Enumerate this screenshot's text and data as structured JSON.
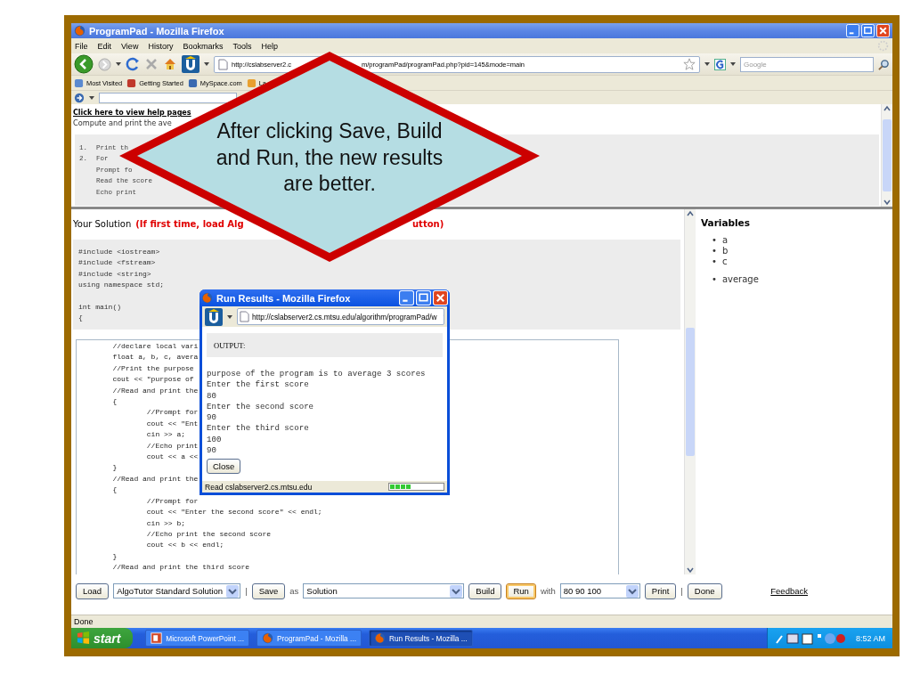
{
  "window": {
    "title": "ProgramPad - Mozilla Firefox"
  },
  "menu": [
    "File",
    "Edit",
    "View",
    "History",
    "Bookmarks",
    "Tools",
    "Help"
  ],
  "address_bar": {
    "url_start": "http://cslabserver2.c",
    "url_end": "m/programPad/programPad.php?pid=145&mode=main"
  },
  "search": {
    "placeholder": "Google"
  },
  "bookmarks": [
    "Most Visited",
    "Getting Started",
    "MySpace.com",
    "La"
  ],
  "help_frame": {
    "link": "Click here to view help pages",
    "description": "Compute and print the ave",
    "steps": [
      {
        "number": "1.",
        "text": "Print th"
      },
      {
        "number": "2.",
        "text": "For"
      },
      {
        "text": "Prompt fo"
      },
      {
        "text": "Read the score"
      },
      {
        "text": "Echo print"
      }
    ]
  },
  "solution": {
    "title": "Your Solution",
    "hint_start": "(If first time, load Alg",
    "hint_end": "utton)",
    "header_code": [
      [
        "#include <iostream>",
        "#include <fstream>",
        "#include <string>",
        "using namespace std;"
      ],
      [
        "int main()",
        "{"
      ]
    ],
    "editor_lines": [
      "\t//declare local vari",
      "\tfloat a, b, c, avera",
      "\t//Print the purpose",
      "\tcout << \"purpose of",
      "\t//Read and print the",
      "\t{",
      "\t\t//Prompt for",
      "\t\tcout << \"Ent",
      "\t\tcin >> a;",
      "\t\t//Echo print",
      "\t\tcout << a <<",
      "\t}",
      "\t//Read and print the",
      "\t{",
      "\t\t//Prompt for",
      "\t\tcout << \"Enter the second score\" << endl;",
      "\t\tcin >> b;",
      "\t\t//Echo print the second score",
      "\t\tcout << b << endl;",
      "\t}",
      "\t//Read and print the third score"
    ]
  },
  "variables": {
    "title": "Variables",
    "marker": "•",
    "groups": [
      [
        "a",
        "b",
        "c"
      ],
      [
        "average"
      ]
    ]
  },
  "controls": [
    {
      "kind": "button",
      "label": "Load",
      "focused": false
    },
    {
      "kind": "select",
      "value": "AlgoTutor Standard Solution"
    },
    {
      "kind": "separator",
      "text": "|"
    },
    {
      "kind": "button",
      "label": "Save",
      "focused": false
    },
    {
      "kind": "text",
      "text": "as"
    },
    {
      "kind": "select",
      "value": "Solution"
    },
    {
      "kind": "button",
      "label": "Build",
      "focused": false
    },
    {
      "kind": "button",
      "label": "Run",
      "focused": true
    },
    {
      "kind": "text",
      "text": "with"
    },
    {
      "kind": "select",
      "value": "80 90 100"
    },
    {
      "kind": "button",
      "label": "Print",
      "focused": false
    },
    {
      "kind": "separator",
      "text": "|"
    },
    {
      "kind": "button",
      "label": "Done",
      "focused": false
    },
    {
      "kind": "link",
      "text": "Feedback"
    }
  ],
  "status": "Done",
  "taskbar": {
    "start": "start",
    "tasks": [
      {
        "kind": "powerpoint",
        "label": "Microsoft PowerPoint ...",
        "selected": false
      },
      {
        "kind": "firefox",
        "label": "ProgramPad - Mozilla ...",
        "selected": false
      },
      {
        "kind": "firefox",
        "label": "Run Results - Mozilla ...",
        "selected": true
      }
    ],
    "clock": "8:52 AM"
  },
  "popup": {
    "title": "Run Results - Mozilla Firefox",
    "url": "http://cslabserver2.cs.mtsu.edu/algorithm/programPad/w",
    "output_label": "OUTPUT:",
    "output_lines": [
      "purpose of the program is to average 3 scores",
      "Enter the first score",
      "80",
      "Enter the second score",
      "90",
      "Enter the third score",
      "100",
      "90"
    ],
    "close_button": "Close",
    "status": "Read cslabserver2.cs.mtsu.edu",
    "progress": {
      "level": 0.4
    }
  },
  "callout": {
    "text": "After clicking Save, Build and Run, the new results are better."
  }
}
